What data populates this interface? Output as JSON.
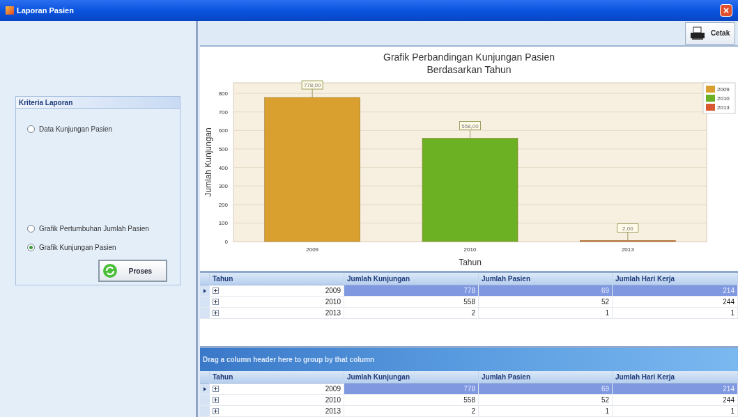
{
  "window": {
    "title": "Laporan Pasien",
    "close": "×"
  },
  "criteria": {
    "title": "Kriteria Laporan",
    "options": [
      {
        "label": "Data Kunjungan Pasien",
        "selected": false
      },
      {
        "label": "Grafik Pertumbuhan Jumlah Pasien",
        "selected": false
      },
      {
        "label": "Grafik Kunjungan Pasien",
        "selected": true
      }
    ],
    "button": "Proses"
  },
  "toolbar": {
    "print_button": "Cetak"
  },
  "chart": {
    "chart_data": {
      "type": "bar",
      "title": "Grafik Perbandingan Kunjungan Pasien Berdasarkan Tahun",
      "xlabel": "Tahun",
      "ylabel": "Jumlah Kunjungan",
      "categories": [
        "2009",
        "2010",
        "2013"
      ],
      "series": [
        {
          "name": "2009",
          "color": "#d9a030",
          "values": [
            778,
            null,
            null
          ]
        },
        {
          "name": "2010",
          "color": "#6cb024",
          "values": [
            null,
            558,
            null
          ]
        },
        {
          "name": "2013",
          "color": "#d95a30",
          "values": [
            null,
            null,
            2
          ]
        }
      ],
      "grid": true,
      "legend": true,
      "ylim": [
        0,
        857
      ],
      "yticks": [
        0,
        100,
        200,
        300,
        400,
        500,
        600,
        700,
        800
      ],
      "value_labels": [
        "778,00",
        "558,00",
        "2,00"
      ]
    }
  },
  "grid": {
    "columns": [
      "Tahun",
      "Jumlah Kunjungan",
      "Jumlah Pasien",
      "Jumlah Hari Kerja"
    ],
    "rows": [
      {
        "selected": true,
        "cells": [
          "2009",
          "778",
          "69",
          "214"
        ]
      },
      {
        "selected": false,
        "cells": [
          "2010",
          "558",
          "52",
          "244"
        ]
      },
      {
        "selected": false,
        "cells": [
          "2013",
          "2",
          "1",
          "1"
        ]
      }
    ]
  },
  "grouped_grid": {
    "group_panel": "Drag a column header here to group by that column",
    "columns": [
      "Tahun",
      "Jumlah Kunjungan",
      "Jumlah Pasien",
      "Jumlah Hari Kerja"
    ],
    "rows": [
      {
        "selected": true,
        "cells": [
          "2009",
          "778",
          "69",
          "214"
        ]
      },
      {
        "selected": false,
        "cells": [
          "2010",
          "558",
          "52",
          "244"
        ]
      },
      {
        "selected": false,
        "cells": [
          "2013",
          "2",
          "1",
          "1"
        ]
      }
    ]
  }
}
